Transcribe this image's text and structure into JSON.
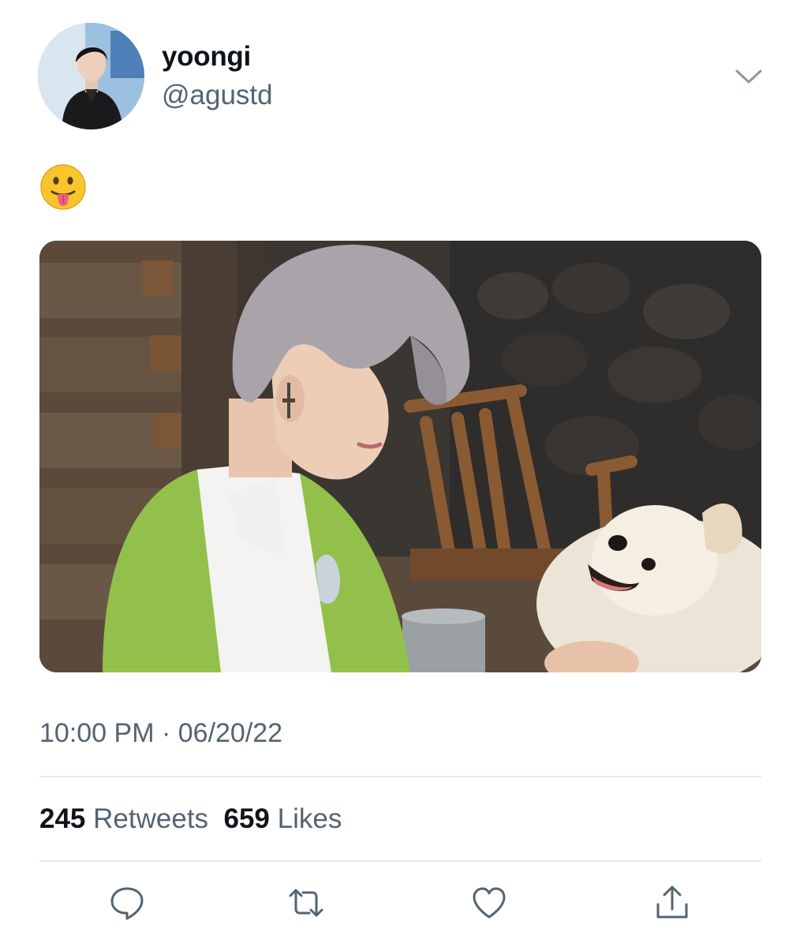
{
  "tweet": {
    "author": {
      "display_name": "yoongi",
      "handle": "@agustd"
    },
    "text": "😛",
    "timestamp": "10:00 PM · 06/20/22",
    "stats": {
      "retweets_count": "245",
      "retweets_label": "Retweets",
      "likes_count": "659",
      "likes_label": "Likes"
    }
  },
  "icons": {
    "more": "chevron-down-icon",
    "reply": "reply-icon",
    "retweet": "retweet-icon",
    "like": "heart-icon",
    "share": "share-icon"
  },
  "colors": {
    "text_primary": "#0f1419",
    "text_secondary": "#536471",
    "icon": "#536471",
    "divider": "#e4e9ec"
  }
}
